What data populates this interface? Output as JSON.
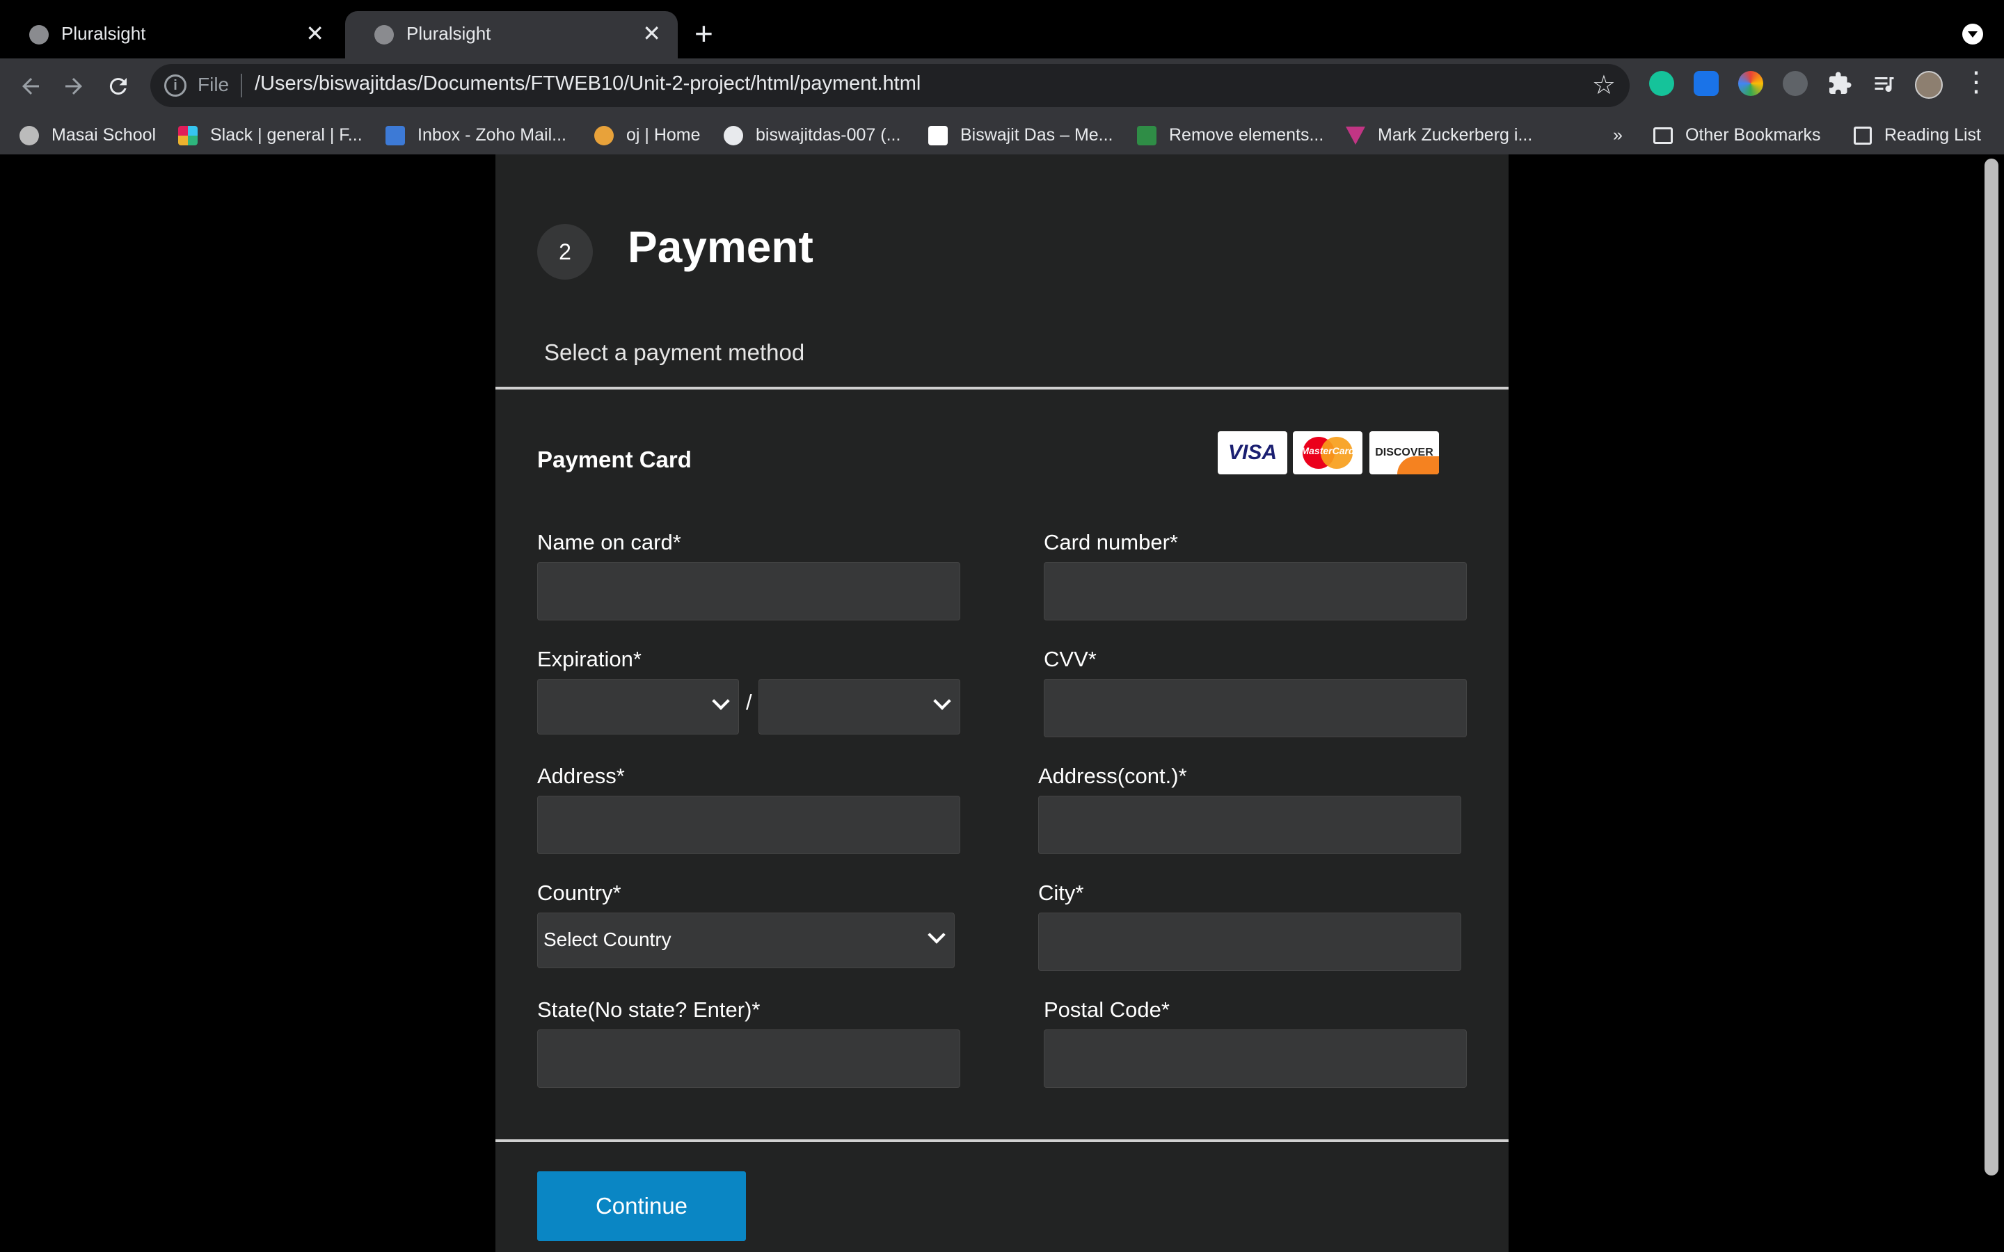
{
  "browser": {
    "tabs": [
      {
        "title": "Pluralsight",
        "active": false
      },
      {
        "title": "Pluralsight",
        "active": true
      }
    ],
    "close_glyph": "✕",
    "new_tab_glyph": "+",
    "omnibox": {
      "scheme_label": "File",
      "url": "/Users/biswajitdas/Documents/FTWEB10/Unit-2-project/html/payment.html"
    },
    "bookmarks": [
      {
        "label": "Masai School",
        "icon": "globe-icon"
      },
      {
        "label": "Slack | general | F...",
        "icon": "slack-icon"
      },
      {
        "label": "Inbox - Zoho Mail...",
        "icon": "zoho-mail-icon"
      },
      {
        "label": "oj | Home",
        "icon": "oj-icon"
      },
      {
        "label": "biswajitdas-007 (...",
        "icon": "github-icon"
      },
      {
        "label": "Biswajit Das – Me...",
        "icon": "medium-icon"
      },
      {
        "label": "Remove elements...",
        "icon": "geeksforgeeks-icon"
      },
      {
        "label": "Mark Zuckerberg i...",
        "icon": "triangle-icon"
      }
    ],
    "overflow_label": "»",
    "other_bookmarks": "Other Bookmarks",
    "reading_list": "Reading List"
  },
  "page": {
    "step_number": "2",
    "heading": "Payment",
    "subheading": "Select a payment method",
    "section_title": "Payment Card",
    "card_brands": [
      "VISA",
      "MasterCard",
      "DISCOVER"
    ],
    "fields": {
      "name_on_card": "Name on card*",
      "card_number": "Card number*",
      "expiration": "Expiration*",
      "expiration_separator": "/",
      "cvv": "CVV*",
      "address": "Address*",
      "address_cont": "Address(cont.)*",
      "country": "Country*",
      "country_selected": "Select Country",
      "city": "City*",
      "state": "State(No state? Enter)*",
      "postal_code": "Postal Code*"
    },
    "continue_label": "Continue"
  },
  "colors": {
    "page_background": "#000000",
    "panel_background": "#222323",
    "input_background": "#373839",
    "button_primary": "#0a86c4"
  }
}
